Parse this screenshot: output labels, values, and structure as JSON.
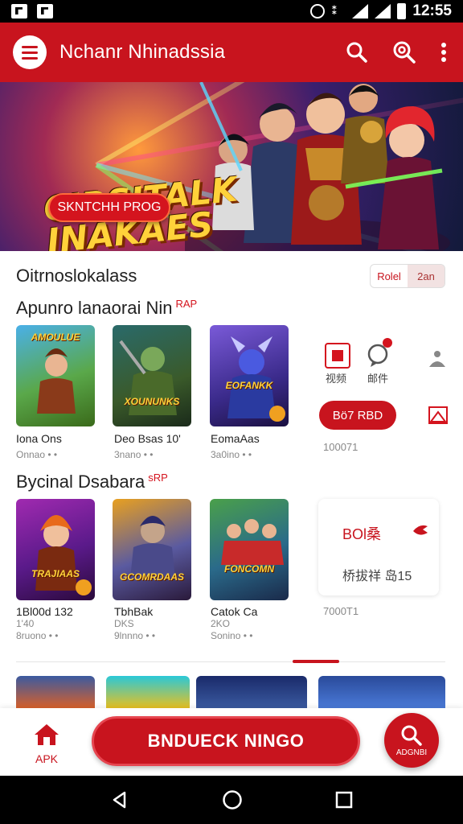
{
  "status_bar": {
    "time": "12:55"
  },
  "app_bar": {
    "title": "Nchanr Nhinadssia"
  },
  "banner": {
    "title_line1": "CIRSITALK",
    "title_line2": "INAKAES",
    "button_label": "SKNTCHH PROG"
  },
  "filter": {
    "label": "Oitrnoslokalass",
    "segments": [
      "Rolel",
      "2an"
    ]
  },
  "section1": {
    "title": "Apunro lanaorai Nin",
    "badge": "RAP",
    "items": [
      {
        "art": "AMOULUE",
        "label": "Iona Ons",
        "meta": "Onnao  • •"
      },
      {
        "art": "XOUNUNKS",
        "label": "Deo Bsas 10'",
        "meta": "3nano  • •"
      },
      {
        "art": "EOFANKK",
        "label": "EomaAas",
        "meta": "3a0ino  • •"
      }
    ],
    "side_icon_labels": [
      "视频",
      "邮件"
    ],
    "side_button": "Bö7 RBD",
    "side_count": "100071"
  },
  "section2": {
    "title": "Bycinal Dsabara",
    "badge": "sRP",
    "items": [
      {
        "art": "TRAJIAAS",
        "label": "1Bl00d 132",
        "sub": "1'40",
        "meta": "8ruono  • •"
      },
      {
        "art": "GCOMRDAAS",
        "label": "TbhBak",
        "sub": "DKS",
        "meta": "9lnnno  • •"
      },
      {
        "art": "FONCOMN",
        "label": "Catok Ca",
        "sub": "2KO",
        "meta": "Sonino  • •"
      }
    ],
    "side_card": {
      "title": "BOl桑",
      "sub": "桥拔祥 岛15"
    },
    "side_count": "7000T1"
  },
  "bottom_bar": {
    "apk_label": "APK",
    "main_button": "BNDUECK NINGO",
    "fab_label": "ADGNBI"
  },
  "colors": {
    "brand_red": "#c8141e"
  }
}
